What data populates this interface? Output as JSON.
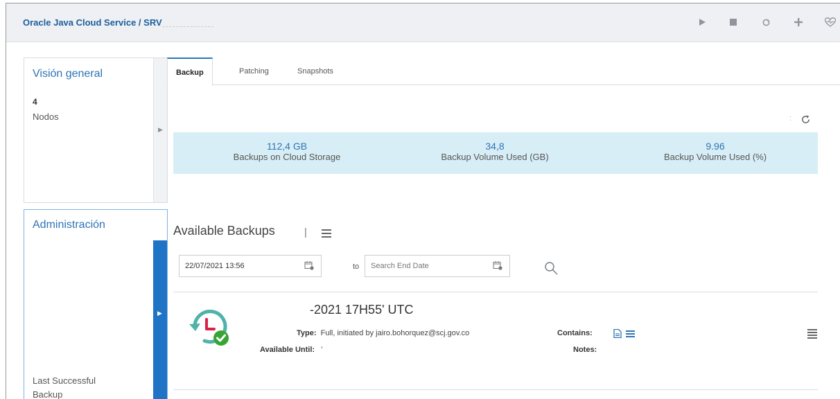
{
  "header": {
    "title": "Oracle Java Cloud Service / SRV ",
    "title_visible": "Oracle Java Cloud Service / SRV",
    "actions": [
      {
        "name": "play-icon",
        "glyph": "▶"
      },
      {
        "name": "stop-icon",
        "glyph": "■"
      },
      {
        "name": "restart-icon",
        "glyph": "↻"
      },
      {
        "name": "add-icon",
        "glyph": "+"
      },
      {
        "name": "health-icon",
        "glyph": "♡"
      }
    ]
  },
  "sidebar": {
    "overview": {
      "title": "Visión general",
      "count": "4",
      "count_label": "Nodos"
    },
    "admin": {
      "title": "Administración",
      "last_label": "Last Successful Backup"
    }
  },
  "tabs": [
    {
      "label": "Backup",
      "active": true
    },
    {
      "label": "Patching",
      "active": false
    },
    {
      "label": "Snapshots",
      "active": false
    }
  ],
  "metrics": [
    {
      "value": "112,4 GB",
      "label": "Backups on Cloud Storage"
    },
    {
      "value": "34,8",
      "label": "Backup Volume Used (GB)"
    },
    {
      "value": "9.96",
      "label": "Backup Volume Used (%)"
    }
  ],
  "available": {
    "title": "Available Backups",
    "separator": "|",
    "start_date": "22/07/2021 13:56",
    "to_label": "to",
    "end_placeholder": "Search End Date"
  },
  "backup_entry": {
    "date": "-2021 17H55' UTC",
    "type_label": "Type:",
    "type_value": "Full, initiated by jairo.bohorquez@scj.gov.co",
    "available_label": "Available Until:",
    "available_value": "'",
    "contains_label": "Contains:",
    "notes_label": "Notes:"
  },
  "colors": {
    "accent": "#2d74b5",
    "metrics_bg": "#d8eef6",
    "active_side": "#1f74c6",
    "success": "#3aa335",
    "clock_red": "#d9214a"
  }
}
